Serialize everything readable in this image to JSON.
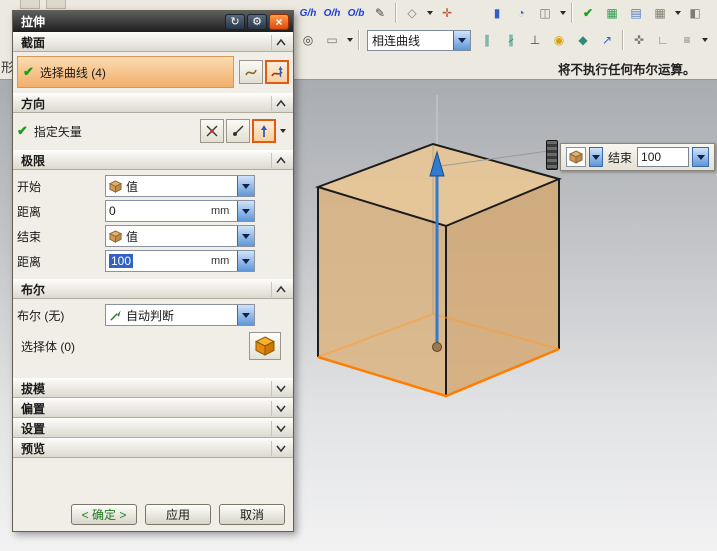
{
  "dialog": {
    "title": "拉伸",
    "titlebar_icons": {
      "reset": "↻",
      "gear": "⚙",
      "close": "×"
    },
    "section": {
      "header": "截面",
      "check": "✔",
      "row_label": "选择曲线  (4)"
    },
    "direction": {
      "header": "方向",
      "check": "✔",
      "row_label": "指定矢量"
    },
    "limits": {
      "header": "极限",
      "start_label": "开始",
      "start_type": "值",
      "start_dist_label": "距离",
      "start_dist_value": "0",
      "start_dist_unit": "mm",
      "end_label": "结束",
      "end_type": "值",
      "end_dist_label": "距离",
      "end_dist_value": "100",
      "end_dist_unit": "mm"
    },
    "boolean": {
      "header": "布尔",
      "type_label": "布尔 (无)",
      "type_value": "自动判断",
      "body_label": "选择体  (0)"
    },
    "collapsed_sections": [
      {
        "label": "拔模"
      },
      {
        "label": "偏置"
      },
      {
        "label": "设置"
      },
      {
        "label": "预览"
      }
    ],
    "buttons": {
      "ok": "< 确定 >",
      "apply": "应用",
      "cancel": "取消"
    }
  },
  "toolbars": {
    "row1": {
      "glyphs": [
        "G/h",
        "O/h",
        "O/b",
        "✎",
        "◇",
        "✛",
        "▮",
        "◔",
        "◫",
        "✔",
        "▦",
        "▤",
        "▦",
        "◧"
      ]
    },
    "row2": {
      "filter_value": "相连曲线",
      "glyphs": [
        "◎",
        "▭",
        "∥",
        "∦",
        "⊥",
        "◉",
        "◆",
        "↗",
        "✜",
        "∟",
        "≡",
        "◨"
      ]
    }
  },
  "status_message": "将不执行任何布尔运算。",
  "floating_bar": {
    "end_label": "结束",
    "end_value": "100"
  },
  "background_glyph": "形",
  "colors": {
    "accent_orange": "#f2ae6a",
    "profile_highlight": "#ff7d00",
    "vector_blue": "#2f7bd0",
    "selection_blue": "#3163c4"
  }
}
